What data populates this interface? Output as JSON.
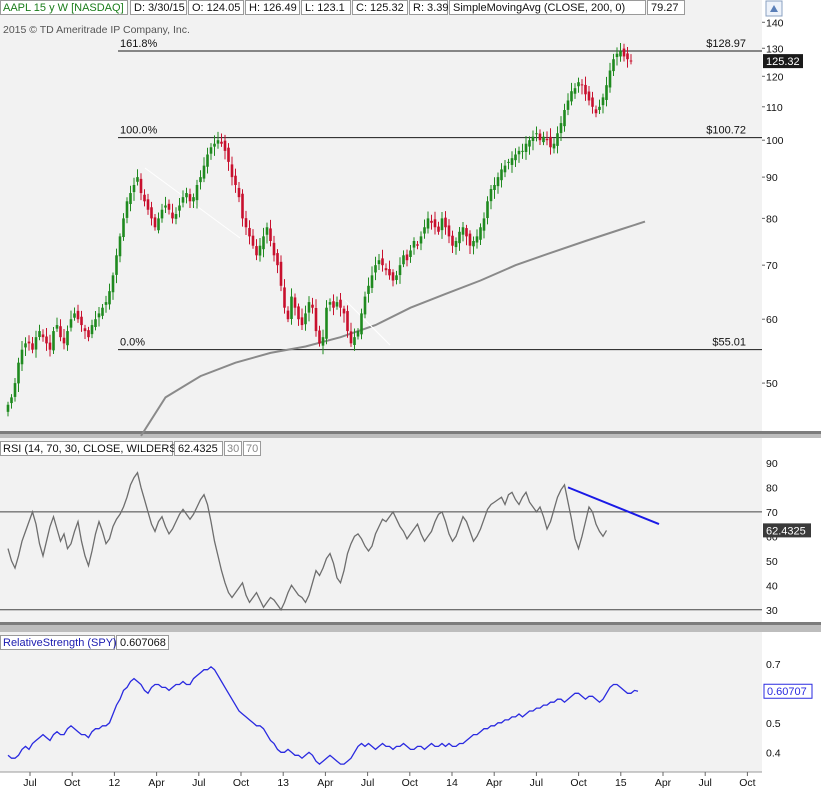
{
  "header": {
    "symbol": "AAPL 15 y W [NASDAQ]",
    "date": "D: 3/30/15",
    "open": "O: 124.05",
    "high": "H: 126.49",
    "low": "L: 123.1",
    "close": "C: 125.32",
    "range": "R: 3.39",
    "study": "SimpleMovingAvg (CLOSE, 200, 0)",
    "study_value": "79.27",
    "copyright": "2015 © TD Ameritrade IP Company, Inc."
  },
  "rsi_header": {
    "label": "RSI (14, 70, 30, CLOSE, WILDERS)",
    "value": "62.4325",
    "ob_label": "30",
    "os_label": "70"
  },
  "rs_header": {
    "label": "RelativeStrength (SPY)",
    "value": "0.607068"
  },
  "colors": {
    "up": "#1f8a1f",
    "down": "#c8102e",
    "sma": "#8a8a8a",
    "rsi": "#6e6e6e",
    "rs_line": "#2a2ae0",
    "trend": "#1a1ae6"
  },
  "chart_data": [
    {
      "type": "candlestick",
      "panel": "price",
      "scale": "log",
      "ylim": [
        45,
        145
      ],
      "yticks": [
        50,
        60,
        70,
        80,
        90,
        100,
        110,
        120,
        130,
        140
      ],
      "last_price": "125.32",
      "x_labels": [
        "Jul",
        "Oct",
        "12",
        "Apr",
        "Jul",
        "Oct",
        "13",
        "Apr",
        "Jul",
        "Oct",
        "14",
        "Apr",
        "Jul",
        "Oct",
        "15",
        "Apr",
        "Jul",
        "Oct"
      ],
      "fib_levels": [
        {
          "label": "161.8%",
          "price": 128.97,
          "price_label": "$128.97"
        },
        {
          "label": "100.0%",
          "price": 100.72,
          "price_label": "$100.72"
        },
        {
          "label": "0.0%",
          "price": 55.01,
          "price_label": "$55.01"
        }
      ],
      "weekly_close": [
        47,
        48,
        50,
        53,
        55,
        56,
        56,
        55,
        57,
        58,
        57,
        56,
        55,
        58,
        59,
        57,
        56,
        58,
        60,
        61,
        60,
        59,
        58,
        57,
        59,
        60,
        61,
        62,
        63,
        65,
        68,
        72,
        76,
        80,
        84,
        86,
        88,
        90,
        86,
        84,
        82,
        80,
        78,
        80,
        82,
        83,
        82,
        80,
        81,
        83,
        85,
        86,
        84,
        85,
        88,
        90,
        93,
        96,
        98,
        99,
        100,
        99,
        97,
        94,
        90,
        88,
        85,
        80,
        78,
        76,
        74,
        72,
        74,
        76,
        78,
        75,
        72,
        70,
        66,
        62,
        60,
        64,
        62,
        60,
        59,
        61,
        63,
        62,
        58,
        56,
        57,
        62,
        63,
        62,
        63,
        62,
        61,
        58,
        56,
        57,
        58,
        61,
        64,
        66,
        68,
        70,
        71,
        70,
        69,
        68,
        67,
        68,
        70,
        72,
        71,
        73,
        75,
        74,
        76,
        78,
        80,
        79,
        78,
        77,
        80,
        78,
        76,
        74,
        75,
        77,
        78,
        76,
        74,
        75,
        76,
        78,
        80,
        84,
        87,
        88,
        90,
        92,
        93,
        94,
        95,
        96,
        97,
        97,
        99,
        100,
        101,
        102,
        100,
        101,
        100,
        98,
        99,
        102,
        105,
        109,
        112,
        115,
        116,
        118,
        117,
        114,
        112,
        110,
        108,
        110,
        113,
        117,
        122,
        126,
        128,
        129,
        127,
        126,
        125.32
      ],
      "sma_200": [
        {
          "week": 38,
          "value": 43
        },
        {
          "week": 45,
          "value": 48
        },
        {
          "week": 55,
          "value": 51
        },
        {
          "week": 65,
          "value": 53
        },
        {
          "week": 75,
          "value": 54.5
        },
        {
          "week": 85,
          "value": 55.5
        },
        {
          "week": 95,
          "value": 57
        },
        {
          "week": 105,
          "value": 59
        },
        {
          "week": 115,
          "value": 62
        },
        {
          "week": 125,
          "value": 64.5
        },
        {
          "week": 135,
          "value": 67
        },
        {
          "week": 145,
          "value": 70
        },
        {
          "week": 155,
          "value": 72.5
        },
        {
          "week": 165,
          "value": 75
        },
        {
          "week": 175,
          "value": 77.5
        },
        {
          "week": 182,
          "value": 79.27
        }
      ]
    },
    {
      "type": "line",
      "panel": "rsi",
      "ylim": [
        25,
        92
      ],
      "yticks": [
        30,
        40,
        50,
        60,
        70,
        80,
        90
      ],
      "overbought": 70,
      "oversold": 30,
      "last_value": "62.4325",
      "values": [
        55,
        50,
        47,
        52,
        58,
        62,
        66,
        70,
        65,
        57,
        52,
        58,
        64,
        68,
        63,
        58,
        61,
        55,
        57,
        62,
        66,
        58,
        52,
        48,
        54,
        61,
        66,
        62,
        57,
        59,
        64,
        67,
        69,
        72,
        76,
        81,
        84,
        86,
        80,
        75,
        70,
        65,
        62,
        66,
        68,
        64,
        61,
        63,
        66,
        69,
        71,
        69,
        67,
        69,
        72,
        75,
        77,
        73,
        66,
        58,
        52,
        46,
        41,
        37,
        35,
        37,
        39,
        41,
        36,
        33,
        35,
        37,
        34,
        31,
        33,
        35,
        34,
        32,
        30,
        33,
        37,
        40,
        38,
        36,
        35,
        33,
        36,
        41,
        46,
        44,
        47,
        51,
        53,
        49,
        43,
        41,
        46,
        53,
        57,
        60,
        61,
        59,
        56,
        54,
        56,
        61,
        64,
        67,
        66,
        68,
        70,
        67,
        64,
        62,
        59,
        61,
        63,
        65,
        61,
        58,
        60,
        62,
        66,
        69,
        70,
        66,
        61,
        58,
        60,
        64,
        68,
        66,
        62,
        58,
        60,
        63,
        67,
        71,
        73,
        74,
        75,
        76,
        73,
        77,
        78,
        75,
        73,
        76,
        78,
        74,
        72,
        70,
        72,
        68,
        63,
        66,
        71,
        76,
        79,
        81,
        74,
        67,
        59,
        55,
        60,
        66,
        72,
        70,
        65,
        62,
        60,
        62.4325
      ],
      "trend_line": [
        {
          "week": 160,
          "value": 80
        },
        {
          "week": 186,
          "value": 65
        }
      ]
    },
    {
      "type": "line",
      "panel": "relative_strength",
      "ylim": [
        0.34,
        0.73
      ],
      "yticks": [
        0.4,
        0.5,
        0.7
      ],
      "last_value": "0.60707",
      "values": [
        0.39,
        0.38,
        0.38,
        0.39,
        0.41,
        0.42,
        0.41,
        0.43,
        0.44,
        0.45,
        0.46,
        0.45,
        0.44,
        0.46,
        0.47,
        0.46,
        0.46,
        0.48,
        0.49,
        0.48,
        0.47,
        0.46,
        0.46,
        0.45,
        0.47,
        0.48,
        0.48,
        0.49,
        0.49,
        0.5,
        0.53,
        0.56,
        0.58,
        0.61,
        0.62,
        0.64,
        0.65,
        0.64,
        0.63,
        0.61,
        0.6,
        0.62,
        0.63,
        0.63,
        0.62,
        0.62,
        0.61,
        0.62,
        0.63,
        0.63,
        0.64,
        0.63,
        0.63,
        0.65,
        0.66,
        0.67,
        0.68,
        0.68,
        0.69,
        0.68,
        0.66,
        0.64,
        0.62,
        0.6,
        0.58,
        0.56,
        0.54,
        0.53,
        0.52,
        0.51,
        0.5,
        0.49,
        0.49,
        0.48,
        0.46,
        0.44,
        0.43,
        0.41,
        0.4,
        0.4,
        0.41,
        0.4,
        0.39,
        0.39,
        0.38,
        0.39,
        0.4,
        0.39,
        0.37,
        0.36,
        0.37,
        0.38,
        0.39,
        0.38,
        0.37,
        0.36,
        0.36,
        0.37,
        0.38,
        0.4,
        0.42,
        0.43,
        0.42,
        0.43,
        0.42,
        0.41,
        0.42,
        0.43,
        0.42,
        0.42,
        0.41,
        0.42,
        0.42,
        0.43,
        0.42,
        0.41,
        0.41,
        0.42,
        0.42,
        0.41,
        0.42,
        0.43,
        0.42,
        0.42,
        0.43,
        0.42,
        0.43,
        0.42,
        0.42,
        0.43,
        0.43,
        0.44,
        0.45,
        0.46,
        0.46,
        0.47,
        0.48,
        0.48,
        0.49,
        0.49,
        0.5,
        0.5,
        0.51,
        0.51,
        0.52,
        0.52,
        0.53,
        0.52,
        0.53,
        0.54,
        0.54,
        0.55,
        0.55,
        0.56,
        0.56,
        0.57,
        0.57,
        0.58,
        0.58,
        0.57,
        0.58,
        0.59,
        0.6,
        0.6,
        0.59,
        0.58,
        0.59,
        0.59,
        0.58,
        0.57,
        0.58,
        0.6,
        0.62,
        0.63,
        0.63,
        0.62,
        0.61,
        0.6,
        0.6,
        0.61,
        0.60707
      ]
    }
  ]
}
